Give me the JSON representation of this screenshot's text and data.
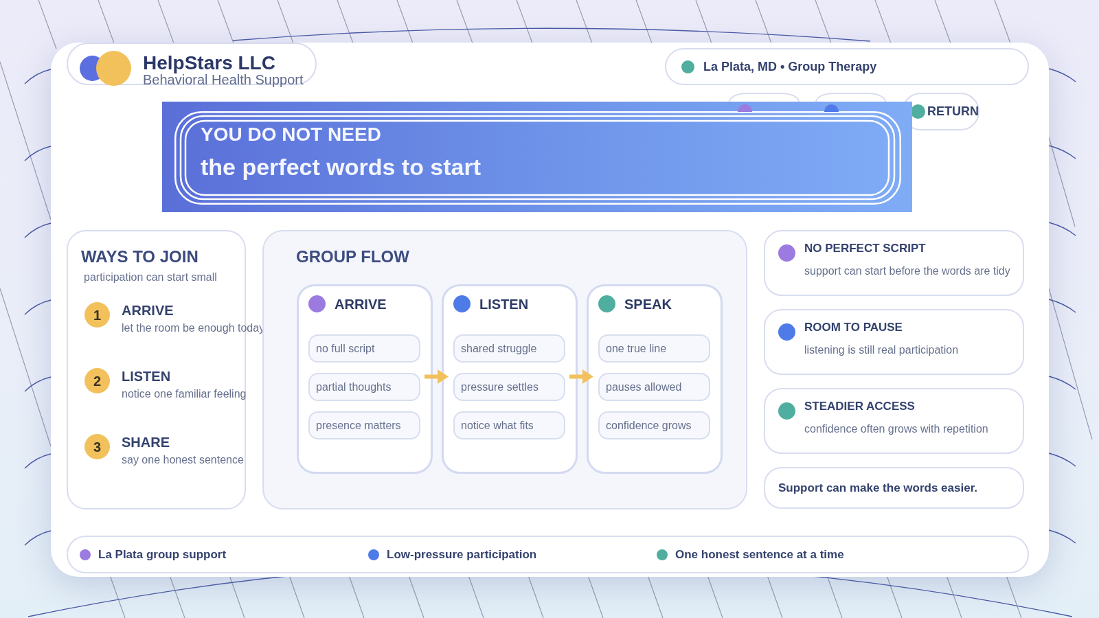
{
  "brand": {
    "name": "HelpStars LLC",
    "tagline": "Behavioral Health Support"
  },
  "location": {
    "label": "La Plata, MD • Group Therapy",
    "color": "#4fae9f"
  },
  "nav_pills": [
    {
      "color": "#9b7be0",
      "covered": true
    },
    {
      "color": "#4f7be8",
      "covered": true
    },
    {
      "label": "RETURN",
      "color": "#4fae9f",
      "covered": false
    }
  ],
  "hero": {
    "eyebrow": "YOU DO NOT NEED",
    "headline": "the perfect words to start"
  },
  "ways_to_join": {
    "title": "WAYS TO JOIN",
    "subtitle": "participation can start small",
    "steps": [
      {
        "number": "1",
        "title": "ARRIVE",
        "description": "let the room be enough today"
      },
      {
        "number": "2",
        "title": "LISTEN",
        "description": "notice one familiar feeling"
      },
      {
        "number": "3",
        "title": "SHARE",
        "description": "say one honest sentence"
      }
    ]
  },
  "group_flow": {
    "title": "GROUP FLOW",
    "stages": [
      {
        "title": "ARRIVE",
        "color": "#9b7be0",
        "chips": [
          "no full script",
          "partial thoughts",
          "presence matters"
        ]
      },
      {
        "title": "LISTEN",
        "color": "#4f7be8",
        "chips": [
          "shared struggle",
          "pressure settles",
          "notice what fits"
        ]
      },
      {
        "title": "SPEAK",
        "color": "#4fae9f",
        "chips": [
          "one true line",
          "pauses allowed",
          "confidence grows"
        ]
      }
    ]
  },
  "notes": [
    {
      "title": "NO PERFECT SCRIPT",
      "description": "support can start before the words are tidy",
      "color": "#9b7be0"
    },
    {
      "title": "ROOM TO PAUSE",
      "description": "listening is still real participation",
      "color": "#4f7be8"
    },
    {
      "title": "STEADIER ACCESS",
      "description": "confidence often grows with repetition",
      "color": "#4fae9f"
    }
  ],
  "callout": "Support can make the words easier.",
  "footer_items": [
    {
      "label": "La Plata group support",
      "color": "#9b7be0"
    },
    {
      "label": "Low-pressure participation",
      "color": "#4f7be8"
    },
    {
      "label": "One honest sentence at a time",
      "color": "#4fae9f"
    }
  ]
}
